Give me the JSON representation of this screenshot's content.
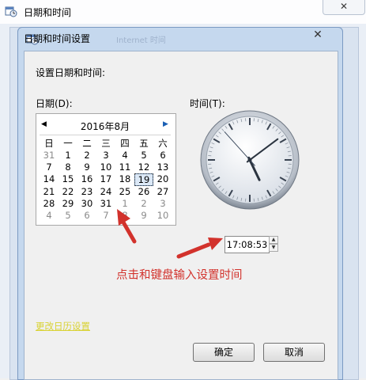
{
  "outer_window": {
    "title": "日期和时间",
    "close_symbol": "✕"
  },
  "dialog": {
    "title": "日期和时间设置",
    "background_ghost_text": "Internet 时间",
    "close_symbol": "✕",
    "set_label": "设置日期和时间:",
    "date_label": "日期(D):",
    "time_label": "时间(T):"
  },
  "calendar": {
    "month_label": "2016年8月",
    "prev_symbol": "◀",
    "next_symbol": "▶",
    "weekdays": [
      "日",
      "一",
      "二",
      "三",
      "四",
      "五",
      "六"
    ],
    "rows": [
      [
        "31",
        "1",
        "2",
        "3",
        "4",
        "5",
        "6"
      ],
      [
        "7",
        "8",
        "9",
        "10",
        "11",
        "12",
        "13"
      ],
      [
        "14",
        "15",
        "16",
        "17",
        "18",
        "19",
        "20"
      ],
      [
        "21",
        "22",
        "23",
        "24",
        "25",
        "26",
        "27"
      ],
      [
        "28",
        "29",
        "30",
        "31",
        "1",
        "2",
        "3"
      ],
      [
        "4",
        "5",
        "6",
        "7",
        "8",
        "9",
        "10"
      ]
    ],
    "selected_day": "19"
  },
  "clock": {
    "hour": 17,
    "minute": 8,
    "second": 53
  },
  "time_value": "17:08:53",
  "spin_up": "▲",
  "spin_down": "▼",
  "annotation": "点击和键盘输入设置时间",
  "change_calendar_link": "更改日历设置",
  "buttons": {
    "ok": "确定",
    "cancel": "取消"
  },
  "colors": {
    "annotation_red": "#d2322c",
    "link_yellow": "#d9d233"
  }
}
